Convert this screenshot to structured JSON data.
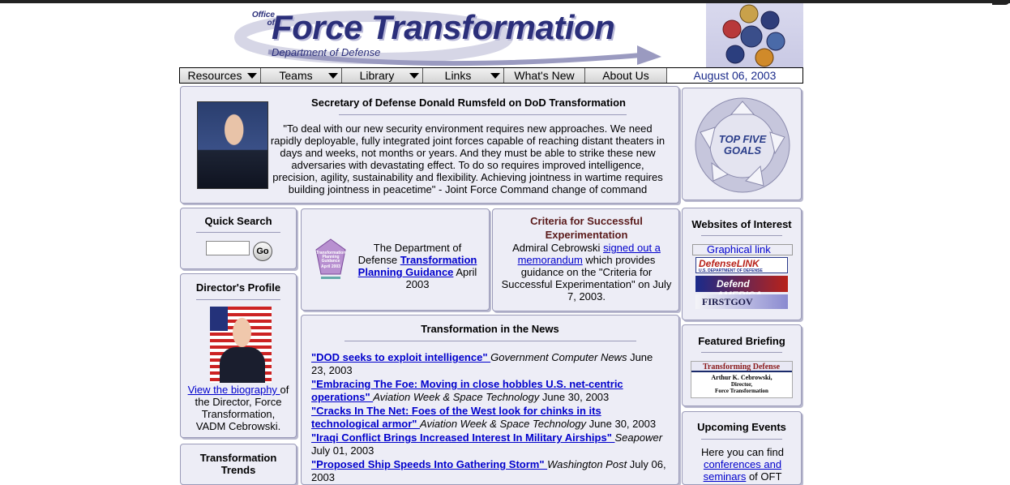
{
  "header": {
    "office": "Office of",
    "office_line1": "Office",
    "office_line2": "of",
    "brand": "Force Transformation",
    "dept": "Department of Defense"
  },
  "nav": {
    "items": [
      {
        "label": "Resources",
        "dropdown": true
      },
      {
        "label": "Teams",
        "dropdown": true
      },
      {
        "label": "Library",
        "dropdown": true
      },
      {
        "label": "Links",
        "dropdown": true
      },
      {
        "label": "What's New",
        "dropdown": false
      },
      {
        "label": "About Us",
        "dropdown": false
      }
    ],
    "date": "August 06, 2003"
  },
  "secdef": {
    "title": "Secretary of Defense Donald Rumsfeld on DoD Transformation",
    "quote": "\"To deal with our new security environment requires new approaches. We need rapidly deployable, fully integrated joint forces capable of reaching distant theaters in days and weeks, not months or years. And they must be able to strike these new adversaries with devastating effect. To do so requires improved intelligence, precision, agility, sustainability and flexibility. Achieving jointness in wartime requires building jointness in peacetime\" - Joint Force Command change of command"
  },
  "goals": {
    "line1": "TOP FIVE",
    "line2": "GOALS"
  },
  "quick_search": {
    "title": "Quick Search",
    "input_value": "",
    "go_label": "Go"
  },
  "tpg": {
    "cover_lines": [
      "Transformation",
      "Planning",
      "Guidance"
    ],
    "cover_date": "April 2003",
    "text_before": "The Department of Defense ",
    "link": "Transformation Planning Guidance",
    "text_after": " April 2003"
  },
  "criteria": {
    "title": "Criteria for Successful Experimentation",
    "text1": "Admiral Cebrowski ",
    "link1": "signed out a memorandum",
    "text2": " which provides guidance on the \"Criteria for Successful Experimentation\" on July 7, 2003."
  },
  "websites": {
    "title": "Websites of Interest",
    "broken_img_alt": "Graphical link",
    "banners": [
      {
        "line1": "DefenseLINK",
        "line2": "U.S. DEPARTMENT OF DEFENSE"
      },
      {
        "line1": "Defend AMERICA"
      },
      {
        "line1": "FIRSTGOV"
      }
    ]
  },
  "director": {
    "title": "Director's Profile",
    "link": "View the biography ",
    "text": "of the Director, Force Transformation, VADM Cebrowski."
  },
  "news": {
    "title": "Transformation in the News",
    "items": [
      {
        "headline": "\"DOD seeks to exploit intelligence\" ",
        "source": "Government Computer News",
        "date": " June 23, 2003"
      },
      {
        "headline": "\"Embracing The Foe: Moving in close hobbles U.S. net-centric operations\" ",
        "source": "Aviation Week & Space Technology",
        "date": " June 30, 2003"
      },
      {
        "headline": "\"Cracks In The Net: Foes of the West look for chinks in its technological armor\" ",
        "source": "Aviation Week & Space Technology",
        "date": " June 30, 2003"
      },
      {
        "headline": "\"Iraqi Conflict Brings Increased Interest In Military Airships\" ",
        "source": "Seapower",
        "date": " July 01, 2003"
      },
      {
        "headline": "\"Proposed Ship Speeds Into Gathering Storm\" ",
        "source": "Washington Post",
        "date": " July 06, 2003"
      }
    ]
  },
  "featured": {
    "title": "Featured Briefing",
    "banner_title": "Transforming Defense",
    "banner_name": "Arthur K. Cebrowski,",
    "banner_role1": "Director,",
    "banner_role2": "Force Transformation"
  },
  "events": {
    "title": "Upcoming Events",
    "text1": "Here you can find ",
    "link": "conferences and seminars",
    "text2": " of OFT"
  },
  "trends": {
    "title": "Transformation Trends"
  },
  "colors": {
    "brand_navy": "#2b2f7a",
    "panel_bg": "#ededf6",
    "link": "#0000cc"
  }
}
